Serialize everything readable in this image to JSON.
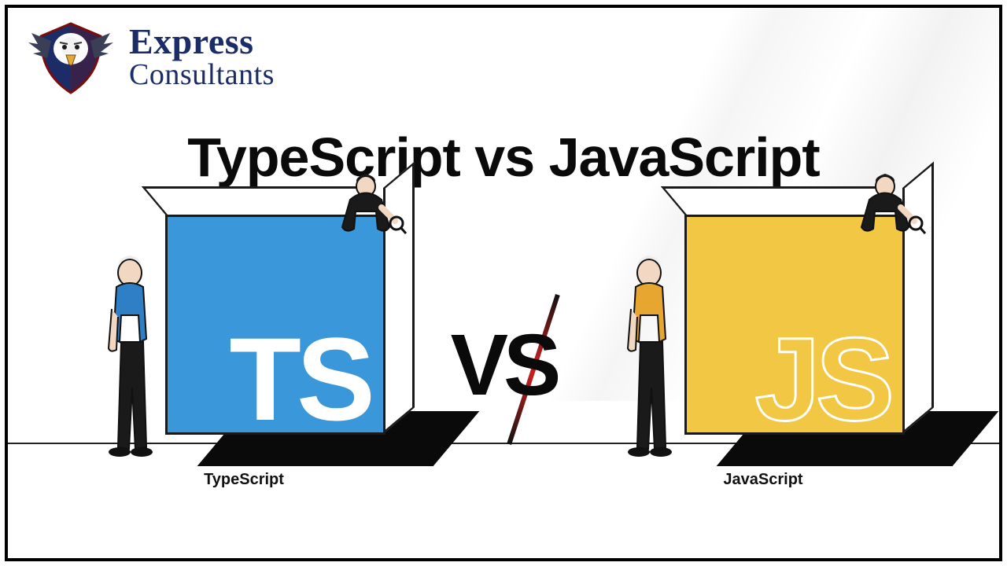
{
  "brand": {
    "line1": "Express",
    "line2": "Consultants",
    "icon_name": "eagle-shield-icon"
  },
  "title": "TypeScript vs JavaScript",
  "vs_text": "VS",
  "left": {
    "box_letters": "TS",
    "caption": "TypeScript",
    "box_color": "#3a97d9"
  },
  "right": {
    "box_letters": "JS",
    "caption": "JavaScript",
    "box_color": "#f2c744"
  }
}
